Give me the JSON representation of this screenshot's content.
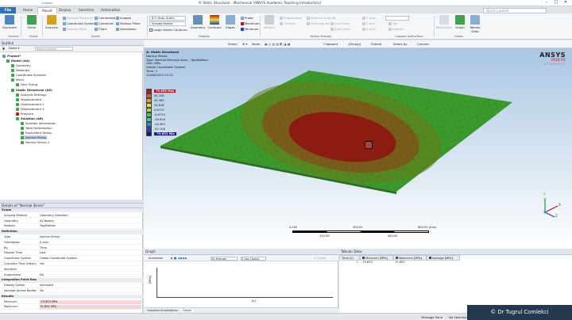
{
  "window": {
    "title": "A: Static Structural - Mechanical [ANSYS Academic Teaching Introductory]",
    "context_label": "Context",
    "controls": [
      "–",
      "□",
      "✕"
    ]
  },
  "menu": {
    "file": "File",
    "tabs": [
      "Home",
      "Result",
      "Display",
      "Selection",
      "Automation"
    ],
    "quick_launch_placeholder": "Quick Launch"
  },
  "ribbon": {
    "duplicate": "Duplicate",
    "solve": "Solve",
    "analysis": "Analysis",
    "method_selection": "Method Selection",
    "coordinate_system": "Coordinate System",
    "remote_point": "Remote Point",
    "commands": "Commands",
    "comment": "Comment",
    "chart": "Chart",
    "images": "Images",
    "section_plane": "Section Plane",
    "annotation": "Annotation",
    "scale_value": "6.9 (Auto Scale)",
    "scoped_bodies": "Scoped Bodies",
    "large_vertex_contours": "Large Vertex Contours",
    "geometry": "Geometry",
    "contours": "Contours",
    "edges": "Edges",
    "probe": "Probe",
    "maximum": "Maximum",
    "minimum": "Minimum",
    "vectors": "Vectors",
    "proportional": "Proportional",
    "uniform": "Uniform",
    "element_aligned": "Element Aligned",
    "grid_aligned": "Grid Aligned",
    "line_form": "Line Form",
    "solid_form": "Solid Form",
    "x_axis": "X Axis",
    "y_axis": "Y Axis",
    "z_axis": "Z Axis",
    "top": "Top",
    "bottom": "Bottom",
    "worksheet": "Worksheet",
    "graph": "Graph",
    "tabular_data": "Tabular Data",
    "groups": [
      "Outline",
      "Solve",
      "Insert",
      "Display",
      "Vector Display",
      "Capped IsoSurface",
      "Views"
    ]
  },
  "outline": {
    "header": "Outline",
    "search_placeholder": "Search Outline",
    "items": [
      {
        "label": "Project*",
        "bold": true
      },
      {
        "label": "Model (A4)",
        "bold": true
      },
      {
        "label": "Geometry",
        "bold": false
      },
      {
        "label": "Materials",
        "bold": false
      },
      {
        "label": "Coordinate Systems",
        "bold": false
      },
      {
        "label": "Mesh",
        "bold": false
      },
      {
        "label": "Face Sizing",
        "bold": false
      },
      {
        "label": "Static Structural (A5)",
        "bold": true
      },
      {
        "label": "Analysis Settings",
        "bold": false
      },
      {
        "label": "Displacement",
        "bold": false
      },
      {
        "label": "Displacement 2",
        "bold": false
      },
      {
        "label": "Displacement 3",
        "bold": false
      },
      {
        "label": "Pressure",
        "bold": false
      },
      {
        "label": "Solution (A6)",
        "bold": true
      },
      {
        "label": "Solution Information",
        "bold": false
      },
      {
        "label": "Total Deformation",
        "bold": false
      },
      {
        "label": "Equivalent Stress",
        "bold": false
      },
      {
        "label": "Normal Stress",
        "bold": false
      },
      {
        "label": "Normal Stress 2",
        "bold": false
      }
    ]
  },
  "details": {
    "header": "Details of \"Normal Stress\"",
    "rows": [
      {
        "k": "Scope",
        "v": "",
        "section": true
      },
      {
        "k": "Scoping Method",
        "v": "Geometry Selection"
      },
      {
        "k": "Geometry",
        "v": "All Bodies"
      },
      {
        "k": "Position",
        "v": "Top/Bottom"
      },
      {
        "k": "Definition",
        "v": "",
        "section": true
      },
      {
        "k": "Type",
        "v": "Normal Stress"
      },
      {
        "k": "Orientation",
        "v": "X Axis"
      },
      {
        "k": "By",
        "v": "Time"
      },
      {
        "k": "Display Time",
        "v": "Last"
      },
      {
        "k": "Coordinate System",
        "v": "Global Coordinate System"
      },
      {
        "k": "Calculate Time History",
        "v": "Yes"
      },
      {
        "k": "Identifier",
        "v": ""
      },
      {
        "k": "Suppressed",
        "v": "No"
      },
      {
        "k": "Integration Point Results",
        "v": "",
        "section": true
      },
      {
        "k": "Display Option",
        "v": "Averaged"
      },
      {
        "k": "Average Across Bodies",
        "v": "No"
      },
      {
        "k": "Results",
        "v": "",
        "section": true
      },
      {
        "k": "Minimum",
        "v": "-79.853 MPa",
        "red": true
      },
      {
        "k": "Maximum",
        "v": "79.853 MPa",
        "red": true
      }
    ]
  },
  "graphics_toolbar": {
    "select": "Select",
    "mode": "Mode",
    "clipboard": "Clipboard",
    "empty": "[Empty]",
    "extend": "Extend",
    "select_by": "Select By",
    "convert": "Convert"
  },
  "viewport": {
    "info_lines": [
      "A: Static Structural",
      "Normal Stress",
      "Type: Normal Stress(X Axis) - Top/Bottom",
      "Unit: MPa",
      "Global Coordinate System",
      "Time: 1",
      "10/08/2019 22:21"
    ],
    "legend": [
      {
        "label": "79.853 Max",
        "color": "#c8101a"
      },
      {
        "label": "62.108",
        "color": "#e05a1a"
      },
      {
        "label": "44.363",
        "color": "#f0a020"
      },
      {
        "label": "26.618",
        "color": "#e8e020"
      },
      {
        "label": "8.8725",
        "color": "#a0e020"
      },
      {
        "label": "-8.8725",
        "color": "#30d050"
      },
      {
        "label": "-26.618",
        "color": "#20d0c0"
      },
      {
        "label": "-44.363",
        "color": "#2090e0"
      },
      {
        "label": "-62.108",
        "color": "#2040d0"
      },
      {
        "label": "-79.853 Min",
        "color": "#1010a0"
      }
    ],
    "logo_name": "ANSYS",
    "logo_version": "2019 R2",
    "logo_edition": "ACADEMIC",
    "scale_labels": [
      "0.000",
      "300.00",
      "600.00 (mm)"
    ],
    "scale_sub_labels": [
      "150.00",
      "450.00"
    ],
    "triad_labels": [
      "Y",
      "Z",
      "X"
    ]
  },
  "graph": {
    "header": "Graph",
    "animation_label": "Animation",
    "frames": "20 Frames",
    "duration": "2 Sec (Auto)",
    "cycles": "3 Cycles",
    "ylabel": "[MPa]",
    "xlabel": "[s]",
    "tabs": [
      "Graphics Annotations",
      "Graph"
    ]
  },
  "tabular": {
    "header": "Tabular Data",
    "columns": [
      "Time [s]",
      "Minimum [MPa]",
      "Maximum [MPa]",
      "Average [MPa]"
    ],
    "rows": [
      [
        "1",
        "-79.853",
        "79.853",
        ""
      ]
    ]
  },
  "status": {
    "message_pane": "Message Pane",
    "no_selection": "No Selection",
    "watermark": "© Dr Tugrul Comlekci"
  },
  "colors": {
    "brand_blue": "#2a72c2",
    "ansys_red": "#c8102e",
    "watermark_bg": "#22394f"
  }
}
